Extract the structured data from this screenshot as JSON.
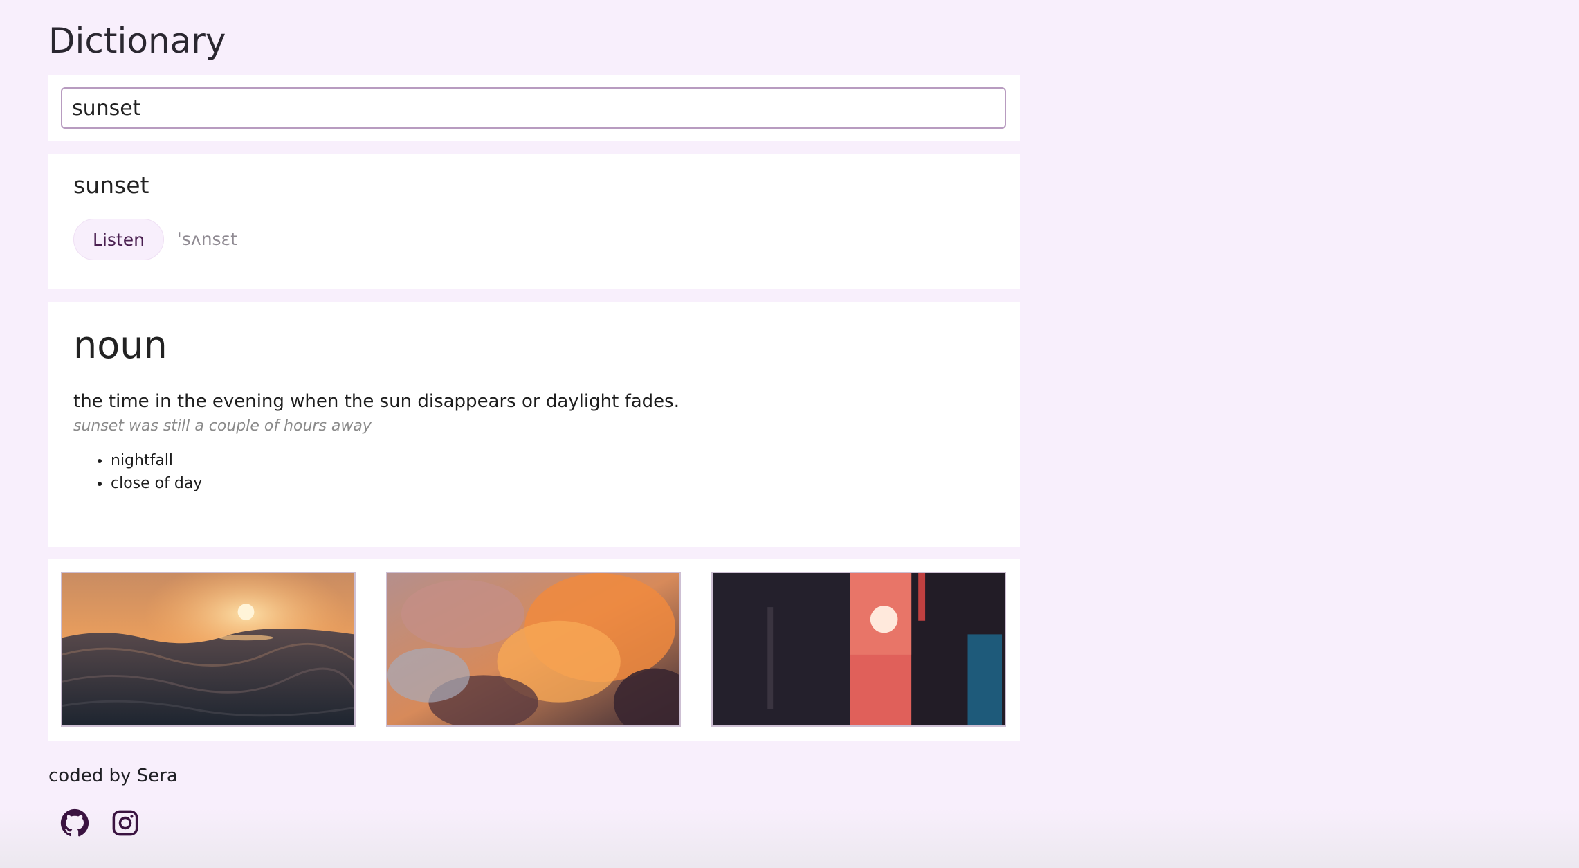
{
  "app": {
    "title": "Dictionary"
  },
  "search": {
    "value": "sunset"
  },
  "word": {
    "text": "sunset",
    "listen_label": "Listen",
    "phonetic": "ˈsʌnsɛt"
  },
  "meaning": {
    "part_of_speech": "noun",
    "definition": "the time in the evening when the sun disappears or daylight fades.",
    "example": "sunset was still a couple of hours away",
    "synonyms": [
      "nightfall",
      "close of day"
    ]
  },
  "photos": [
    {
      "icon": "sunset-over-ocean-photo"
    },
    {
      "icon": "sunset-clouds-photo"
    },
    {
      "icon": "city-street-sunset-photo"
    }
  ],
  "footer": {
    "credit": "coded by Sera",
    "social": [
      {
        "icon": "github-icon"
      },
      {
        "icon": "instagram-icon"
      }
    ]
  },
  "colors": {
    "background": "#f8effc",
    "accent": "#4a1f50",
    "input_border": "#b89cc0"
  }
}
